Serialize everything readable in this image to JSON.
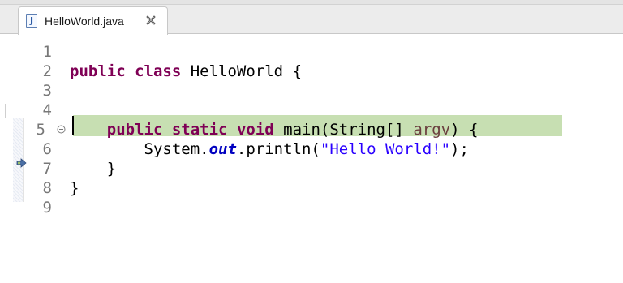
{
  "tab": {
    "file_name": "HelloWorld.java",
    "file_icon_glyph": "J",
    "close_icon": "close-icon"
  },
  "editor": {
    "current_line": 6,
    "highlight_color": "#c7dfb2",
    "lines": [
      {
        "number": "1",
        "segments": []
      },
      {
        "number": "2",
        "segments": [
          {
            "text": "public",
            "kind": "keyword"
          },
          {
            "text": " ",
            "kind": "plain"
          },
          {
            "text": "class",
            "kind": "keyword"
          },
          {
            "text": " HelloWorld {",
            "kind": "plain"
          }
        ]
      },
      {
        "number": "3",
        "segments": []
      },
      {
        "number": "4",
        "segments": []
      },
      {
        "number": "5",
        "folding": true,
        "segments": [
          {
            "text": "    ",
            "kind": "plain"
          },
          {
            "text": "public",
            "kind": "keyword"
          },
          {
            "text": " ",
            "kind": "plain"
          },
          {
            "text": "static",
            "kind": "keyword"
          },
          {
            "text": " ",
            "kind": "plain"
          },
          {
            "text": "void",
            "kind": "keyword"
          },
          {
            "text": " main(String[] ",
            "kind": "plain"
          },
          {
            "text": "argv",
            "kind": "parameter"
          },
          {
            "text": ") {",
            "kind": "plain"
          }
        ]
      },
      {
        "number": "6",
        "segments": [
          {
            "text": "        System.",
            "kind": "plain"
          },
          {
            "text": "out",
            "kind": "static-field"
          },
          {
            "text": ".println(",
            "kind": "plain"
          },
          {
            "text": "\"Hello World!\"",
            "kind": "string"
          },
          {
            "text": ");",
            "kind": "plain"
          }
        ]
      },
      {
        "number": "7",
        "segments": [
          {
            "text": "    }",
            "kind": "plain"
          }
        ]
      },
      {
        "number": "8",
        "segments": [
          {
            "text": "}",
            "kind": "plain"
          }
        ]
      },
      {
        "number": "9",
        "segments": []
      }
    ]
  },
  "colors": {
    "keyword": "#7f0055",
    "static_field": "#0000c0",
    "string": "#2a00ff",
    "parameter": "#6a3e3e",
    "line_number": "#787878"
  },
  "icons": {
    "fold": "minus-circle-icon",
    "debug_pointer": "instruction-pointer-icon"
  }
}
